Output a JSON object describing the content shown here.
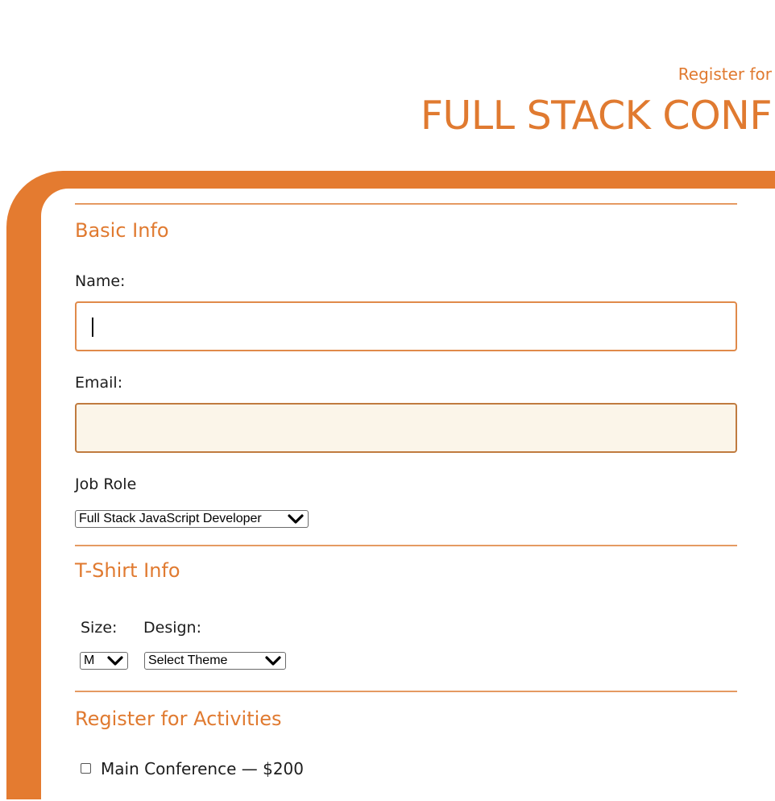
{
  "header": {
    "subtitle": "Register for",
    "title": "FULL STACK CONF"
  },
  "basic_info": {
    "title": "Basic Info",
    "name_label": "Name:",
    "name_value": "",
    "email_label": "Email:",
    "email_value": "",
    "job_role_label": "Job Role",
    "job_role_selected": "Full Stack JavaScript Developer"
  },
  "tshirt_info": {
    "title": "T-Shirt Info",
    "size_label": "Size:",
    "size_selected": "M",
    "design_label": "Design:",
    "design_selected": "Select Theme"
  },
  "activities": {
    "title": "Register for Activities",
    "items": [
      {
        "label": "Main Conference — $200",
        "checked": false
      }
    ]
  },
  "colors": {
    "accent": "#e47b30",
    "email_field_bg": "#fbf5e9"
  },
  "icons": {
    "select_arrow": "chevron-down-icon"
  }
}
